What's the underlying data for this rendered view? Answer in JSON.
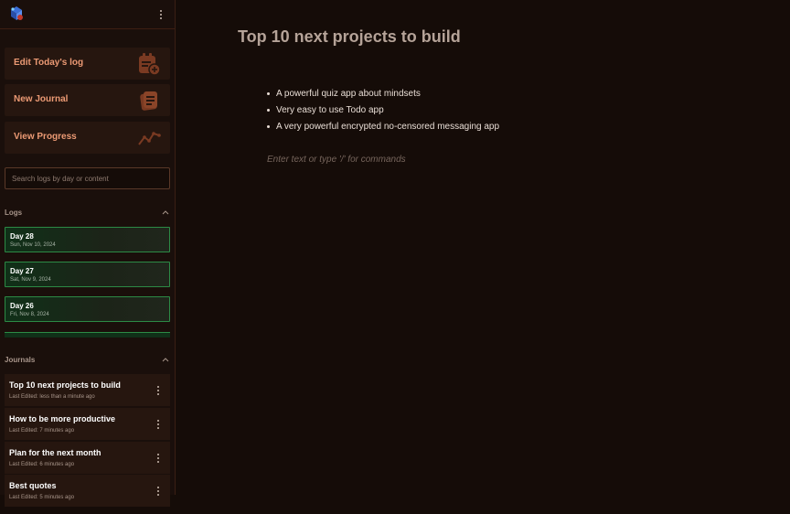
{
  "sidebar": {
    "actions": [
      {
        "label": "Edit Today's log",
        "icon": "calendar-edit-icon"
      },
      {
        "label": "New Journal",
        "icon": "notebook-icon"
      },
      {
        "label": "View Progress",
        "icon": "trend-line-icon"
      }
    ],
    "search": {
      "placeholder": "Search logs by day or content"
    },
    "logs": {
      "title": "Logs",
      "items": [
        {
          "day": "Day 28",
          "date": "Sun, Nov 10, 2024"
        },
        {
          "day": "Day 27",
          "date": "Sat, Nov 9, 2024"
        },
        {
          "day": "Day 26",
          "date": "Fri, Nov 8, 2024"
        }
      ]
    },
    "journals": {
      "title": "Journals",
      "items": [
        {
          "title": "Top 10 next projects to build",
          "edited": "Last Edited: less than a minute ago"
        },
        {
          "title": "How to be more productive",
          "edited": "Last Edited: 7 minutes ago"
        },
        {
          "title": "Plan for the next month",
          "edited": "Last Edited: 6 minutes ago"
        },
        {
          "title": "Best quotes",
          "edited": "Last Edited: 5 minutes ago"
        }
      ]
    }
  },
  "editor": {
    "title": "Top 10 next projects to build",
    "bullets": [
      "A powerful quiz app about mindsets",
      "Very easy to use Todo app",
      "A very powerful encrypted no-censored messaging app"
    ],
    "placeholder": "Enter text or type '/' for commands"
  },
  "colors": {
    "background": "#150c08",
    "sidebar": "#1a0f0b",
    "card": "#26160f",
    "accent": "#ec9a74",
    "log_border": "#2c8a45"
  }
}
